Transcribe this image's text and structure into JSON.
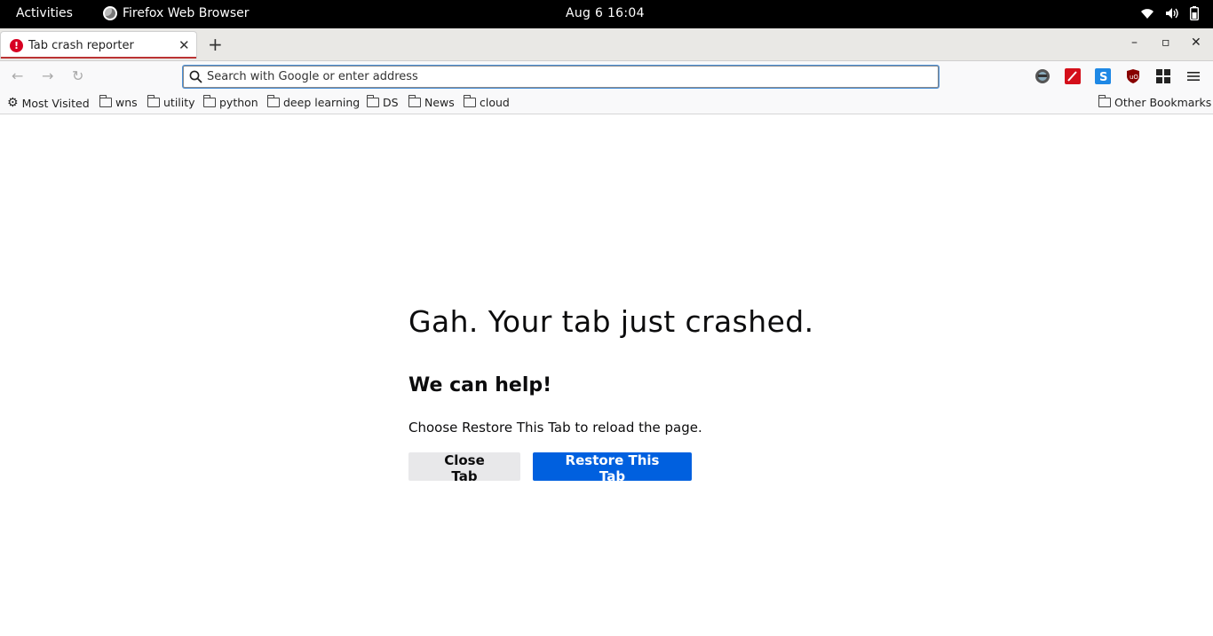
{
  "system_bar": {
    "activities": "Activities",
    "app_name": "Firefox Web Browser",
    "clock": "Aug 6  16:04",
    "tray_icons": [
      "wifi-icon",
      "volume-icon",
      "battery-icon"
    ]
  },
  "tabs": [
    {
      "title": "Tab crash reporter",
      "icon": "alert-icon",
      "active": true
    }
  ],
  "window_controls": {
    "minimize": "–",
    "maximize": "▫",
    "close": "✕"
  },
  "navbar": {
    "url_placeholder": "Search with Google or enter address",
    "url_value": "",
    "extensions": [
      "profile-icon",
      "pen-extension-icon",
      "s-extension-icon",
      "ublock-icon",
      "extensions-grid-icon",
      "menu-icon"
    ]
  },
  "bookmarks": {
    "items": [
      "Most Visited",
      "wns",
      "utility",
      "python",
      "deep learning",
      "DS",
      "News",
      "cloud"
    ],
    "other": "Other Bookmarks"
  },
  "crash_page": {
    "title": "Gah. Your tab just crashed.",
    "subtitle": "We can help!",
    "message": "Choose Restore This Tab to reload the page.",
    "close_button": "Close Tab",
    "restore_button": "Restore This Tab"
  },
  "colors": {
    "primary_button": "#0060df",
    "alert": "#d70022"
  }
}
